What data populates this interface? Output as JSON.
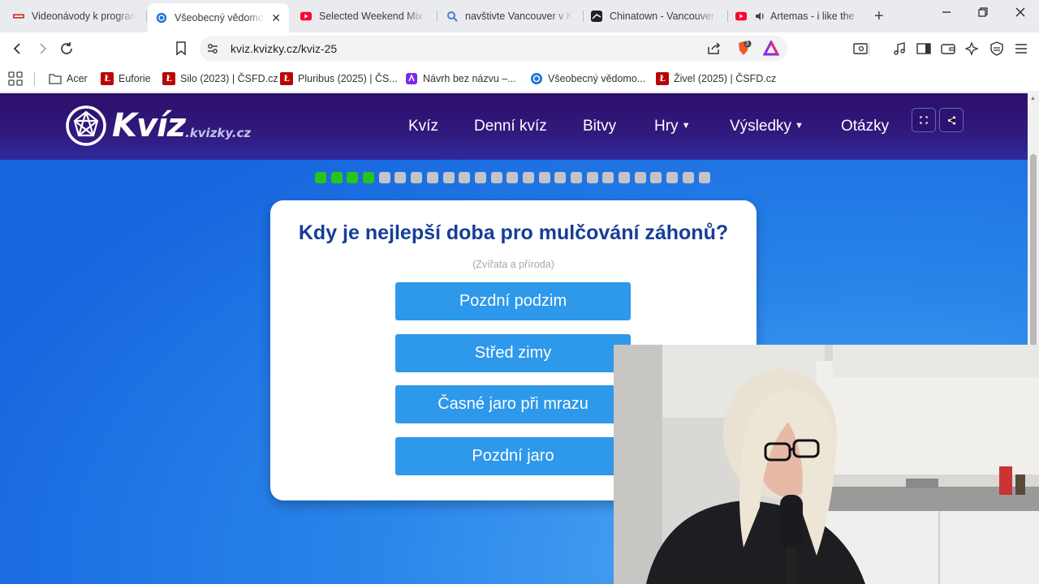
{
  "browser": {
    "tabs": [
      {
        "title": "Videonávody k program",
        "active": false,
        "icon": "acer-favicon"
      },
      {
        "title": "Všeobecný vědomo",
        "active": true,
        "icon": "kviz-favicon"
      },
      {
        "title": "Selected Weekend Mix",
        "active": false,
        "icon": "youtube-favicon"
      },
      {
        "title": "navštivte Vancouver v K",
        "active": false,
        "icon": "search-favicon"
      },
      {
        "title": "Chinatown - Vancouver",
        "active": false,
        "icon": "chinatown-favicon"
      },
      {
        "title": "Artemas - i like the",
        "active": false,
        "icon": "youtube-favicon",
        "audio": true
      }
    ],
    "url": "kviz.kvizky.cz/kviz-25",
    "shields_count": "3",
    "bookmarks": [
      {
        "label": "Acer",
        "icon": "folder-icon"
      },
      {
        "label": "Euforie",
        "icon": "csfd-icon"
      },
      {
        "label": "Silo (2023) | ČSFD.cz",
        "icon": "csfd-icon"
      },
      {
        "label": "Pluribus (2025) | ČS...",
        "icon": "csfd-icon"
      },
      {
        "label": "Návrh bez názvu –...",
        "icon": "canva-icon"
      },
      {
        "label": "Všeobecný vědomo...",
        "icon": "kviz-favicon"
      },
      {
        "label": "Živel (2025) | ČSFD.cz",
        "icon": "csfd-icon"
      }
    ]
  },
  "site": {
    "logo_text": "Kvíz",
    "logo_domain": ".kvizky.cz",
    "nav": [
      "Kvíz",
      "Denní kvíz",
      "Bitvy",
      "Hry",
      "Výsledky",
      "Otázky"
    ]
  },
  "quiz": {
    "progress_total": 25,
    "progress_done": 4,
    "question": "Kdy je nejlepší doba pro mulčování záhonů?",
    "category": "(Zvířata a příroda)",
    "answers": [
      "Pozdní podzim",
      "Střed zimy",
      "Časné jaro při mrazu",
      "Pozdní jaro"
    ]
  },
  "colors": {
    "nav_bg": "#2b0f69",
    "question": "#173e96",
    "answer_bg": "#2e98ea",
    "progress_done": "#27c41d",
    "progress_todo": "#c2c4c8"
  }
}
